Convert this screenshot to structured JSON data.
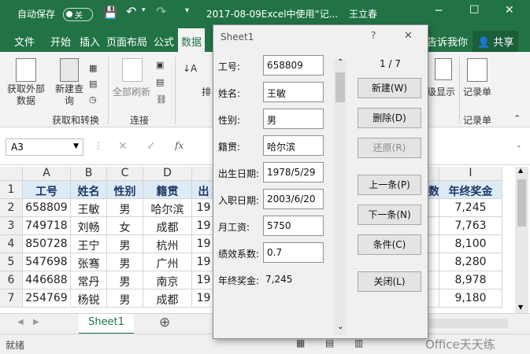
{
  "titlebar": {
    "autosave_label": "自动保存",
    "autosave_state": "关",
    "doc_title": "2017-08-09Excel中使用“记...",
    "user": "王立春"
  },
  "menu": {
    "file": "文件",
    "home": "开始",
    "insert": "插入",
    "layout": "页面布局",
    "formulas": "公式",
    "data": "数据",
    "tell_me": "告诉我你",
    "share": "共享"
  },
  "ribbon": {
    "get_external": "获取外部数据",
    "new_query": "新建查询",
    "refresh_all": "全部刷新",
    "sort": "排",
    "show_levels": "级显示",
    "record_form": "记录单",
    "group_get_transform": "获取和转换",
    "group_connections": "连接",
    "group_record": "记录单"
  },
  "formula_bar": {
    "name_box": "A3",
    "cancel": "✕",
    "enter": "✓",
    "fx": "fx"
  },
  "sheet": {
    "col_headers": [
      "A",
      "B",
      "C",
      "D",
      "I"
    ],
    "row_numbers": [
      "1",
      "2",
      "3",
      "4",
      "5",
      "6",
      "7"
    ],
    "header_row": [
      "工号",
      "姓名",
      "性别",
      "籍贯",
      "出",
      "数",
      "年终奖金"
    ],
    "rows": [
      [
        "658809",
        "王敏",
        "男",
        "哈尔滨",
        "19",
        "7,245"
      ],
      [
        "749718",
        "刘畅",
        "女",
        "成都",
        "19",
        "7,763"
      ],
      [
        "850728",
        "王宁",
        "男",
        "杭州",
        "19",
        "8,100"
      ],
      [
        "547698",
        "张骞",
        "男",
        "广州",
        "19",
        "8,280"
      ],
      [
        "446688",
        "常丹",
        "男",
        "南京",
        "19",
        "8,978"
      ],
      [
        "254769",
        "杨锐",
        "男",
        "成都",
        "19",
        "9,180"
      ]
    ]
  },
  "sheet_tabs": {
    "active": "Sheet1",
    "add": "⊕"
  },
  "status": {
    "ready": "就绪",
    "watermark": "Office天天练"
  },
  "dialog": {
    "title": "Sheet1",
    "help": "?",
    "close": "✕",
    "record_counter": "1 / 7",
    "fields": [
      {
        "label": "工号:",
        "value": "658809"
      },
      {
        "label": "姓名:",
        "value": "王敏"
      },
      {
        "label": "性别:",
        "value": "男"
      },
      {
        "label": "籍贯:",
        "value": "哈尔滨"
      },
      {
        "label": "出生日期:",
        "value": "1978/5/29"
      },
      {
        "label": "入职日期:",
        "value": "2003/6/20"
      },
      {
        "label": "月工资:",
        "value": "5750"
      },
      {
        "label": "绩效系数:",
        "value": "0.7"
      }
    ],
    "computed_label": "年终奖金:",
    "computed_value": "7,245",
    "buttons": {
      "new": "新建(W)",
      "delete": "删除(D)",
      "restore": "还原(R)",
      "prev": "上一条(P)",
      "next": "下一条(N)",
      "criteria": "条件(C)",
      "close": "关闭(L)"
    }
  },
  "colors": {
    "excel_green": "#217346",
    "header_fill": "#ddebf7"
  }
}
